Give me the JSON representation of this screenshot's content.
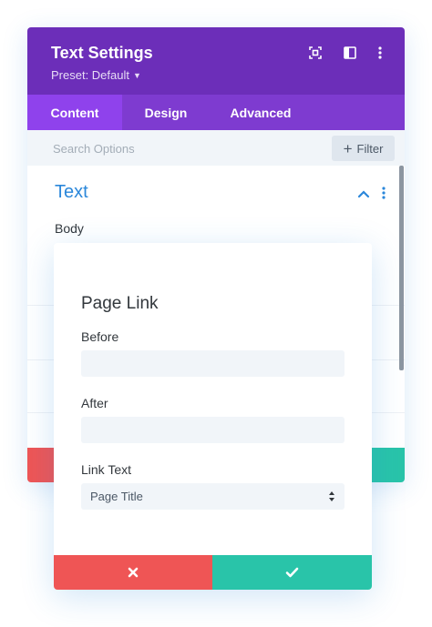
{
  "header": {
    "title": "Text Settings",
    "preset_label": "Preset: Default"
  },
  "header_icons": [
    "focus-icon",
    "sidebar-layout-icon",
    "more-vertical-icon"
  ],
  "tabs": [
    {
      "label": "Content",
      "active": true
    },
    {
      "label": "Design",
      "active": false
    },
    {
      "label": "Advanced",
      "active": false
    }
  ],
  "search": {
    "placeholder": "Search Options",
    "filter_label": "Filter"
  },
  "section": {
    "title": "Text",
    "body_label": "Body"
  },
  "popup": {
    "title": "Page Link",
    "fields": [
      {
        "label": "Before",
        "value": ""
      },
      {
        "label": "After",
        "value": ""
      }
    ],
    "link_text": {
      "label": "Link Text",
      "selected": "Page Title"
    }
  },
  "colors": {
    "header": "#6c2eb9",
    "tabs": "#7e3bd0",
    "active_tab": "#8f42ec",
    "accent": "#2b87da",
    "cancel": "#ef5555",
    "save": "#29c4a9"
  }
}
